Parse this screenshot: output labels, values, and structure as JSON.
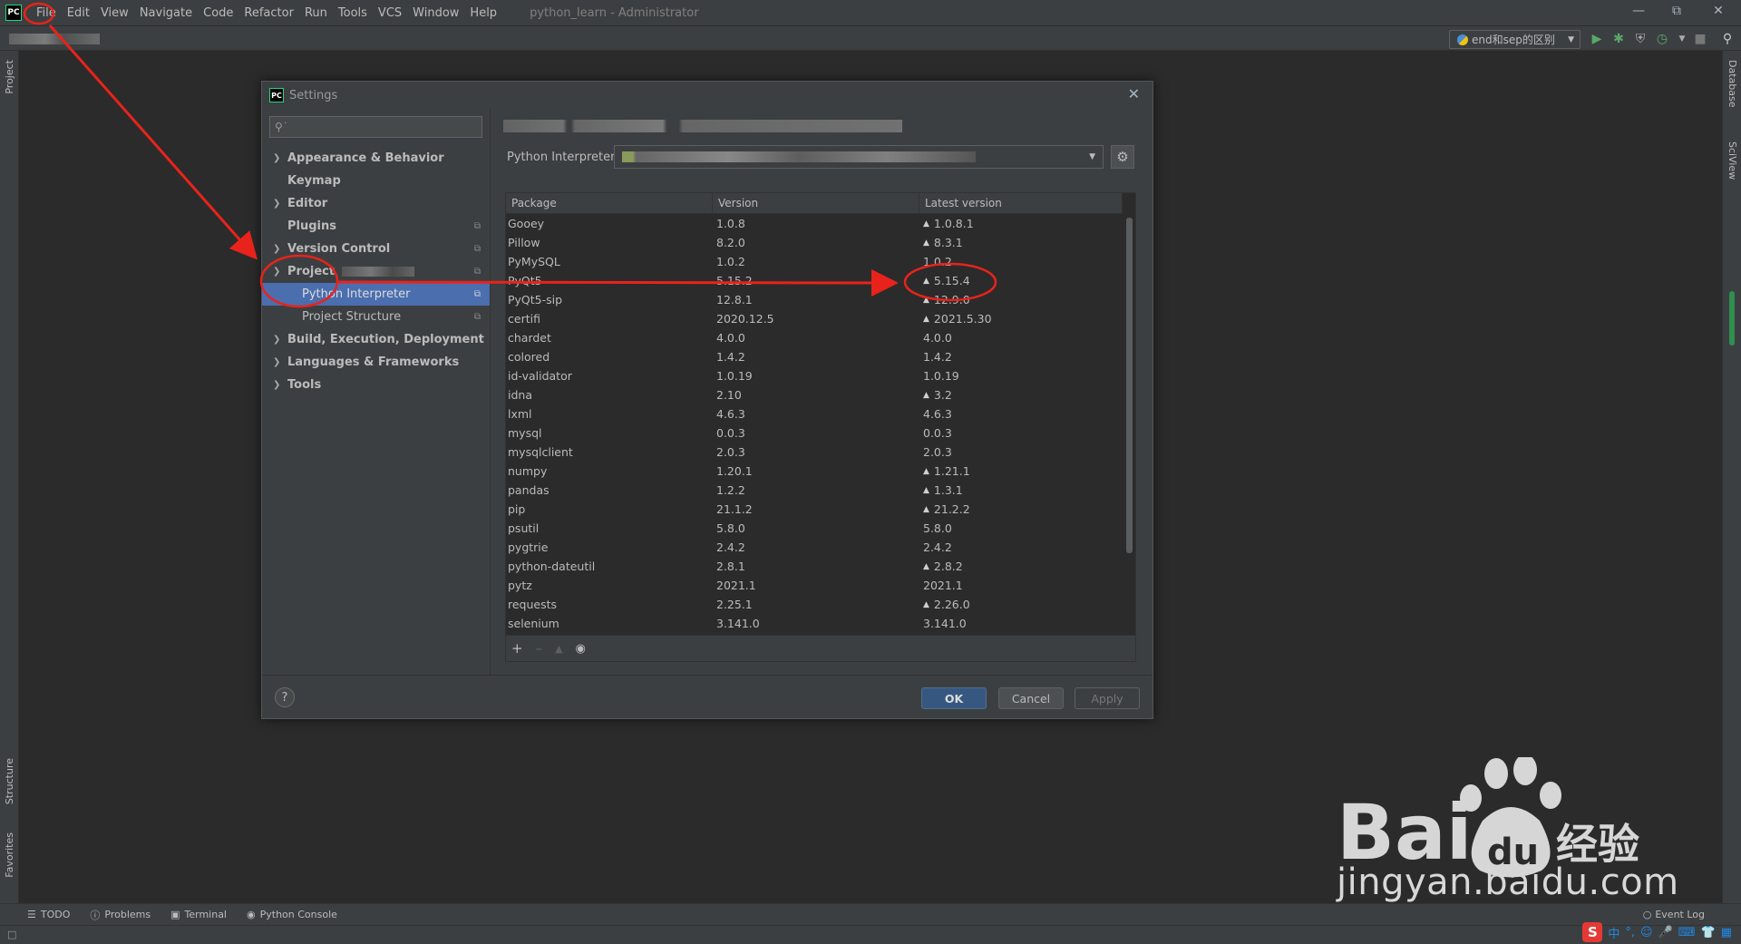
{
  "menubar": {
    "logo": "PC",
    "items": [
      "File",
      "Edit",
      "View",
      "Navigate",
      "Code",
      "Refactor",
      "Run",
      "Tools",
      "VCS",
      "Window",
      "Help"
    ],
    "window_title": "python_learn - Administrator"
  },
  "toolbar": {
    "run_config": "end和sep的区别"
  },
  "left_stripe": {
    "project_tab": "Project",
    "structure_tab": "Structure",
    "favorites_tab": "Favorites"
  },
  "right_stripe": {
    "database_tab": "Database",
    "sciview_tab": "SciView"
  },
  "bottom_tabs": {
    "todo": "TODO",
    "problems": "Problems",
    "terminal": "Terminal",
    "python_console": "Python Console",
    "event_log": "Event Log"
  },
  "ime": {
    "logo": "S",
    "lang": "中"
  },
  "dialog": {
    "title": "Settings",
    "logo": "PC",
    "tree": [
      {
        "label": "Appearance & Behavior"
      },
      {
        "label": "Keymap"
      },
      {
        "label": "Editor"
      },
      {
        "label": "Plugins"
      },
      {
        "label": "Version Control"
      },
      {
        "label": "Project"
      },
      {
        "label": "Python Interpreter"
      },
      {
        "label": "Project Structure"
      },
      {
        "label": "Build, Execution, Deployment"
      },
      {
        "label": "Languages & Frameworks"
      },
      {
        "label": "Tools"
      }
    ],
    "interpreter_label": "Python Interpreter:",
    "table_headers": [
      "Package",
      "Version",
      "Latest version"
    ],
    "packages": [
      {
        "name": "Gooey",
        "version": "1.0.8",
        "latest": "1.0.8.1",
        "upgrade": true
      },
      {
        "name": "Pillow",
        "version": "8.2.0",
        "latest": "8.3.1",
        "upgrade": true
      },
      {
        "name": "PyMySQL",
        "version": "1.0.2",
        "latest": "1.0.2",
        "upgrade": false
      },
      {
        "name": "PyQt5",
        "version": "5.15.2",
        "latest": "5.15.4",
        "upgrade": true
      },
      {
        "name": "PyQt5-sip",
        "version": "12.8.1",
        "latest": "12.9.0",
        "upgrade": true
      },
      {
        "name": "certifi",
        "version": "2020.12.5",
        "latest": "2021.5.30",
        "upgrade": true
      },
      {
        "name": "chardet",
        "version": "4.0.0",
        "latest": "4.0.0",
        "upgrade": false
      },
      {
        "name": "colored",
        "version": "1.4.2",
        "latest": "1.4.2",
        "upgrade": false
      },
      {
        "name": "id-validator",
        "version": "1.0.19",
        "latest": "1.0.19",
        "upgrade": false
      },
      {
        "name": "idna",
        "version": "2.10",
        "latest": "3.2",
        "upgrade": true
      },
      {
        "name": "lxml",
        "version": "4.6.3",
        "latest": "4.6.3",
        "upgrade": false
      },
      {
        "name": "mysql",
        "version": "0.0.3",
        "latest": "0.0.3",
        "upgrade": false
      },
      {
        "name": "mysqlclient",
        "version": "2.0.3",
        "latest": "2.0.3",
        "upgrade": false
      },
      {
        "name": "numpy",
        "version": "1.20.1",
        "latest": "1.21.1",
        "upgrade": true
      },
      {
        "name": "pandas",
        "version": "1.2.2",
        "latest": "1.3.1",
        "upgrade": true
      },
      {
        "name": "pip",
        "version": "21.1.2",
        "latest": "21.2.2",
        "upgrade": true
      },
      {
        "name": "psutil",
        "version": "5.8.0",
        "latest": "5.8.0",
        "upgrade": false
      },
      {
        "name": "pygtrie",
        "version": "2.4.2",
        "latest": "2.4.2",
        "upgrade": false
      },
      {
        "name": "python-dateutil",
        "version": "2.8.1",
        "latest": "2.8.2",
        "upgrade": true
      },
      {
        "name": "pytz",
        "version": "2021.1",
        "latest": "2021.1",
        "upgrade": false
      },
      {
        "name": "requests",
        "version": "2.25.1",
        "latest": "2.26.0",
        "upgrade": true
      },
      {
        "name": "selenium",
        "version": "3.141.0",
        "latest": "3.141.0",
        "upgrade": false
      }
    ],
    "buttons": {
      "help": "?",
      "ok": "OK",
      "cancel": "Cancel",
      "apply": "Apply"
    }
  },
  "watermark": {
    "brand": "Bai",
    "brand_suffix": "du",
    "chinese": "经验",
    "url": "jingyan.baidu.com"
  },
  "colors": {
    "annotation": "#e8231b",
    "selection": "#4b6eaf",
    "ok_button": "#365880"
  }
}
